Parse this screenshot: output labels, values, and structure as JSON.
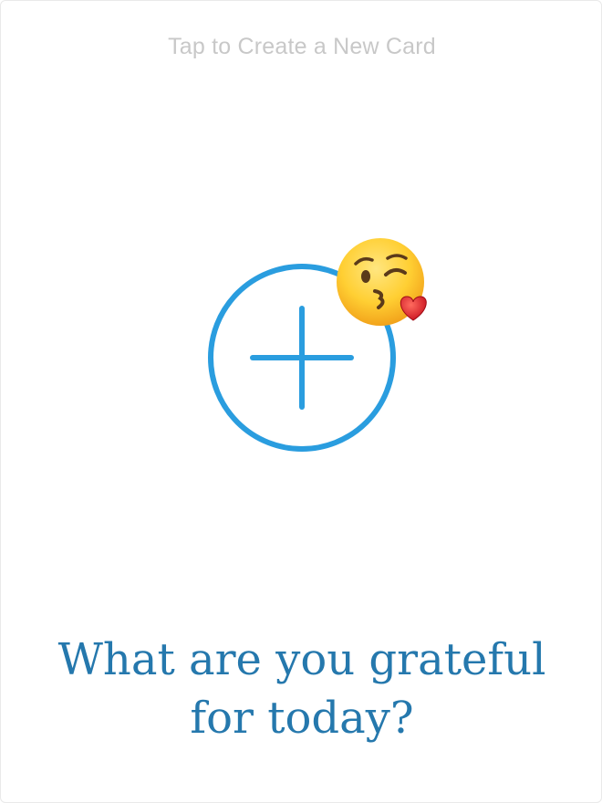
{
  "header": {
    "hint": "Tap to Create a New Card"
  },
  "add_button": {
    "icon": "plus-icon",
    "color": "#2a9ddf"
  },
  "emoji": {
    "icon": "face-blowing-kiss-icon"
  },
  "prompt": {
    "line1": "What are you grateful",
    "line2": "for today?",
    "color": "#2578ad"
  }
}
